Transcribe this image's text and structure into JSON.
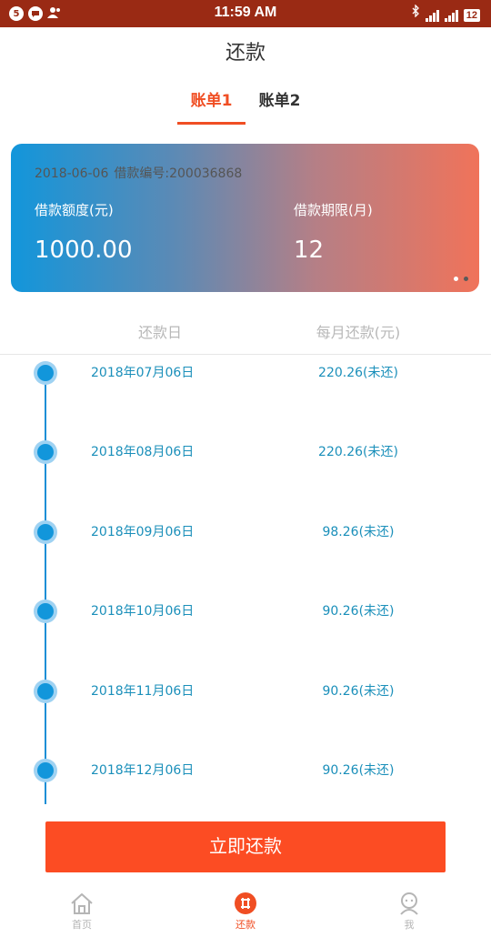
{
  "status_bar": {
    "time": "11:59 AM",
    "battery": "12",
    "left_badge": "5"
  },
  "header": {
    "title": "还款"
  },
  "tabs": [
    {
      "label": "账单1",
      "active": true
    },
    {
      "label": "账单2",
      "active": false
    }
  ],
  "loan_card": {
    "date": "2018-06-06",
    "loan_number": "借款编号:200036868",
    "amount_label": "借款额度(元)",
    "amount_value": "1000.00",
    "term_label": "借款期限(月)",
    "term_value": "12",
    "pager_count": 2,
    "pager_active_index": 0
  },
  "schedule": {
    "date_header": "还款日",
    "amount_header": "每月还款(元)",
    "rows": [
      {
        "date": "2018年07月06日",
        "amount": "220.26(未还)"
      },
      {
        "date": "2018年08月06日",
        "amount": "220.26(未还)"
      },
      {
        "date": "2018年09月06日",
        "amount": "98.26(未还)"
      },
      {
        "date": "2018年10月06日",
        "amount": "90.26(未还)"
      },
      {
        "date": "2018年11月06日",
        "amount": "90.26(未还)"
      },
      {
        "date": "2018年12月06日",
        "amount": "90.26(未还)"
      }
    ]
  },
  "pay_button": {
    "label": "立即还款"
  },
  "bottom_nav": [
    {
      "label": "首页",
      "icon": "home-icon",
      "active": false
    },
    {
      "label": "还款",
      "icon": "repay-icon",
      "active": true
    },
    {
      "label": "我",
      "icon": "profile-icon",
      "active": false
    }
  ],
  "colors": {
    "accent": "#f04e23",
    "status_bar": "#9a2a14",
    "timeline_blue": "#1296db",
    "row_text": "#1a8fba",
    "card_gradient_start": "#1296db",
    "card_gradient_end": "#f0735a"
  }
}
